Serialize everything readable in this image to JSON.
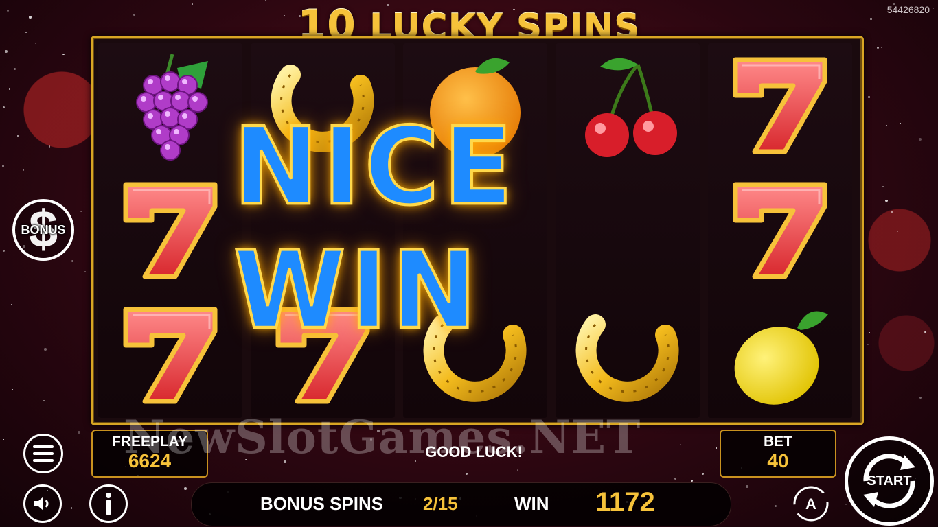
{
  "header": {
    "title_number": "10",
    "title_text": "LUCKY SPINS",
    "session_id": "54426820"
  },
  "reels": [
    [
      "grapes",
      "seven",
      "seven"
    ],
    [
      "horseshoe",
      "hidden",
      "seven"
    ],
    [
      "orange",
      "hidden",
      "horseshoe"
    ],
    [
      "cherries",
      "hidden",
      "horseshoe"
    ],
    [
      "seven",
      "seven",
      "lemon"
    ]
  ],
  "win_banner": "NICE WIN",
  "bonus_badge": {
    "label": "BONUS",
    "icon": "dollar-icon"
  },
  "freeplay": {
    "label": "FREEPLAY",
    "value": "6624"
  },
  "bet": {
    "label": "BET",
    "value": "40"
  },
  "status_message": "GOOD LUCK!",
  "watermark": "NewSlotGames.NET",
  "bottom_bar": {
    "bonus_spins_label": "BONUS SPINS",
    "bonus_spins_value": "2/15",
    "win_label": "WIN",
    "win_value": "1172"
  },
  "controls": {
    "menu_icon": "menu-icon",
    "sound_icon": "speaker-icon",
    "info_icon": "info-icon",
    "autoplay_icon": "autoplay-icon",
    "start_label": "START"
  },
  "colors": {
    "gold": "#f6c23a",
    "frame": "#d9a624",
    "win_blue": "#1e8bff",
    "background": "#2a0610"
  }
}
